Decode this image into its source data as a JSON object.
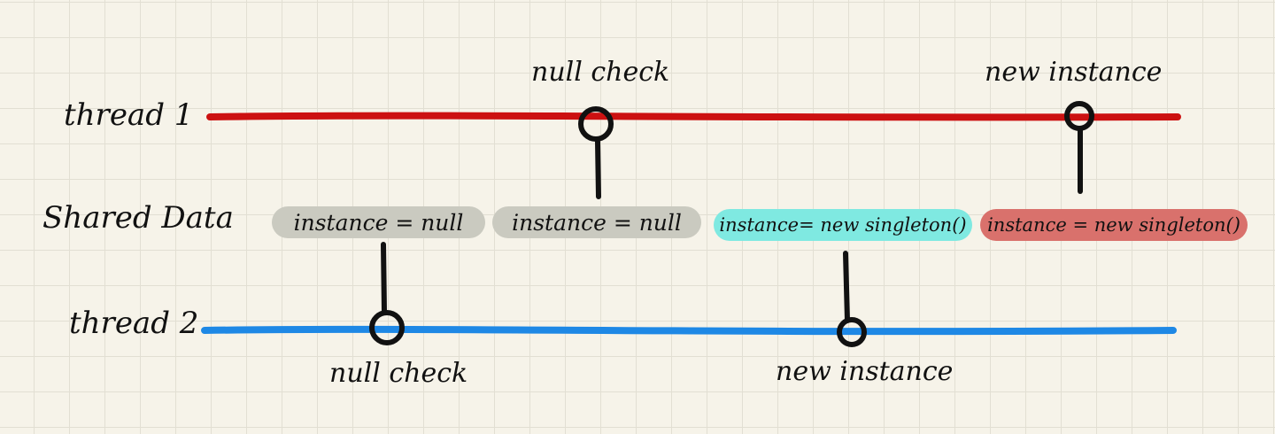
{
  "rows": {
    "thread1": "thread 1",
    "shared": "Shared Data",
    "thread2": "thread 2"
  },
  "thread1_events": {
    "null_check": "null check",
    "new_instance": "new instance"
  },
  "thread2_events": {
    "null_check": "null check",
    "new_instance": "new instance"
  },
  "shared_states": [
    {
      "text": "instance = null",
      "color": "#cacac0"
    },
    {
      "text": "instance = null",
      "color": "#cacac0"
    },
    {
      "text": "instance= new singleton()",
      "color": "#7fe9e1"
    },
    {
      "text": "instance = new singleton()",
      "color": "#d9716c"
    }
  ],
  "colors": {
    "thread1_line": "#cc1111",
    "thread2_line": "#1e88e5",
    "ink": "#111111"
  }
}
